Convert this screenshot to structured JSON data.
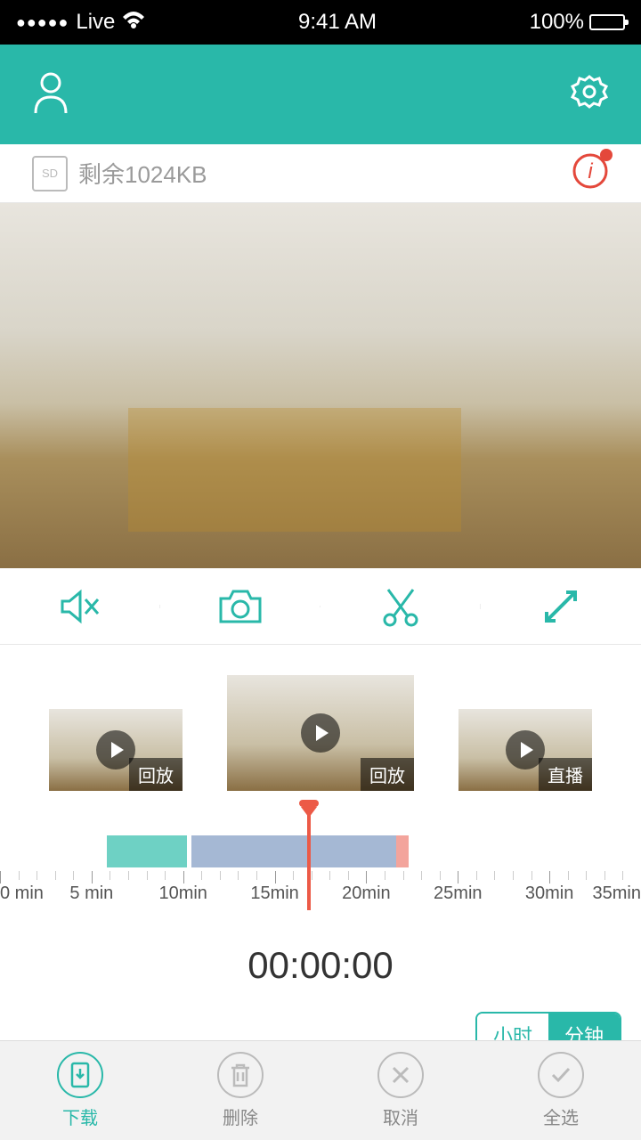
{
  "status_bar": {
    "carrier": "Live",
    "time": "9:41 AM",
    "battery": "100%"
  },
  "storage": {
    "label": "剩余1024KB"
  },
  "icons": {
    "profile": "profile-icon",
    "settings": "gear-icon",
    "info": "info-icon",
    "mute": "mute-icon",
    "camera": "camera-icon",
    "scissors": "scissors-icon",
    "expand": "expand-icon",
    "download": "download-icon",
    "trash": "trash-icon",
    "close": "close-icon",
    "check": "check-icon"
  },
  "thumbnails": [
    {
      "label": "回放"
    },
    {
      "label": "回放"
    },
    {
      "label": "直播"
    }
  ],
  "timeline": {
    "ticks": [
      "0 min",
      "5 min",
      "10min",
      "15min",
      "20min",
      "25min",
      "30min",
      "35min"
    ],
    "timer": "00:00:00",
    "segments": [
      {
        "color": "teal",
        "start_min": 6,
        "end_min": 10
      },
      {
        "color": "blue",
        "start_min": 10.5,
        "end_min": 22
      },
      {
        "color": "red",
        "start_min": 22,
        "end_min": 22.7
      }
    ],
    "playhead_min": 17
  },
  "unit_toggle": {
    "hour": "小时",
    "minute": "分钟",
    "active": "minute"
  },
  "bottom": {
    "download": "下载",
    "delete": "删除",
    "cancel": "取消",
    "select_all": "全选"
  },
  "colors": {
    "accent": "#29b8a9",
    "danger": "#e4483b"
  }
}
